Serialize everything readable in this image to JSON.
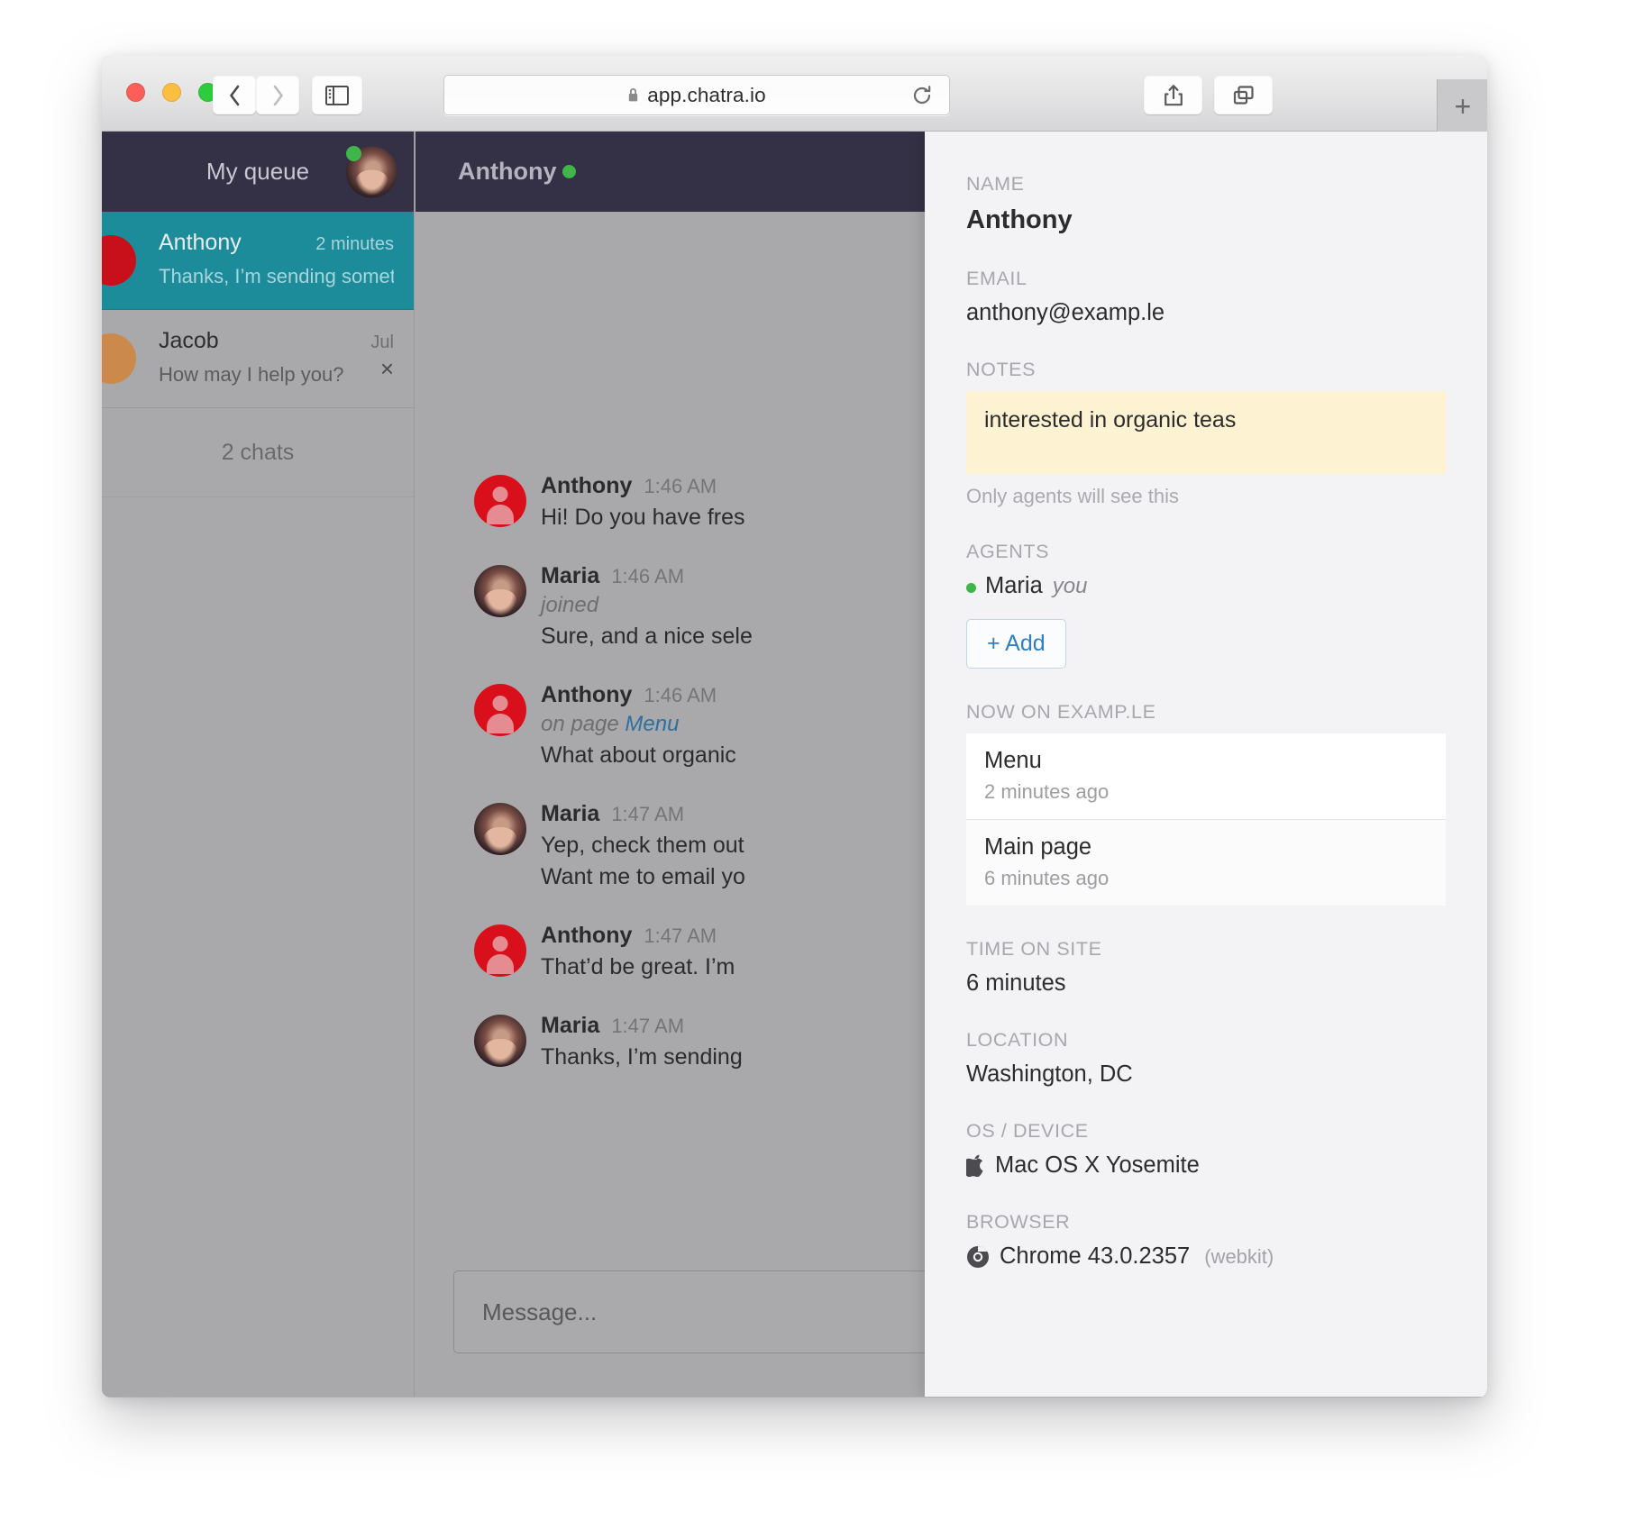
{
  "browser": {
    "url": "app.chatra.io",
    "lock_icon": "lock-icon",
    "back_icon": "chevron-left-icon",
    "forward_icon": "chevron-right-icon",
    "sidebar_icon": "sidebar-toggle-icon",
    "reload_icon": "reload-icon",
    "share_icon": "share-icon",
    "tabs_icon": "show-all-tabs-icon",
    "new_tab_label": "+"
  },
  "queue": {
    "title": "My queue",
    "avatar_name": "maria-avatar",
    "status": "online",
    "count_label": "2 chats",
    "items": [
      {
        "name": "Anthony",
        "time": "2 minutes",
        "preview": "Thanks, I’m sending somet…",
        "active": true
      },
      {
        "name": "Jacob",
        "time": "Jul",
        "preview": "How may I help you?",
        "active": false,
        "close_label": "×"
      }
    ]
  },
  "conversation": {
    "header_name": "Anthony",
    "header_status": "online",
    "messages": [
      {
        "author": "Anthony",
        "time": "1:46 AM",
        "avatar": "visitor",
        "meta": "",
        "body": "Hi! Do you have fres"
      },
      {
        "author": "Maria",
        "time": "1:46 AM",
        "avatar": "agent",
        "meta": "joined",
        "body": "Sure, and a nice sele"
      },
      {
        "author": "Anthony",
        "time": "1:46 AM",
        "avatar": "visitor",
        "meta": "on page ",
        "meta_link": "Menu",
        "body": "What about organic"
      },
      {
        "author": "Maria",
        "time": "1:47 AM",
        "avatar": "agent",
        "meta": "",
        "body": "Yep, check them out",
        "body2": "Want me to email yo"
      },
      {
        "author": "Anthony",
        "time": "1:47 AM",
        "avatar": "visitor",
        "meta": "",
        "body": "That’d be great. I’m"
      },
      {
        "author": "Maria",
        "time": "1:47 AM",
        "avatar": "agent",
        "meta": "",
        "body": "Thanks, I’m sending"
      }
    ],
    "composer_placeholder": "Message..."
  },
  "details": {
    "name_label": "NAME",
    "name_value": "Anthony",
    "email_label": "EMAIL",
    "email_value": "anthony@examp.le",
    "notes_label": "NOTES",
    "notes_value": "interested in organic teas",
    "notes_hint": "Only agents will see this",
    "agents_label": "AGENTS",
    "agent_name": "Maria",
    "agent_you": "you",
    "add_agent_label": "+ Add",
    "now_on_label": "NOW ON EXAMP.LE",
    "pages": [
      {
        "title": "Menu",
        "ago": "2 minutes ago"
      },
      {
        "title": "Main page",
        "ago": "6 minutes ago"
      }
    ],
    "time_on_site_label": "TIME ON SITE",
    "time_on_site_value": "6 minutes",
    "location_label": "LOCATION",
    "location_value": "Washington, DC",
    "os_label": "OS / DEVICE",
    "os_value": "Mac OS X Yosemite",
    "os_icon": "apple-icon",
    "browser_label": "BROWSER",
    "browser_value": "Chrome 43.0.2357",
    "browser_engine": "(webkit)",
    "browser_icon": "chrome-icon"
  },
  "colors": {
    "accent_teal": "#1c8c9b",
    "header_dark": "#343146",
    "status_green": "#3fb54a",
    "note_yellow": "#fdf3d2",
    "link_blue": "#2e7fc4"
  }
}
